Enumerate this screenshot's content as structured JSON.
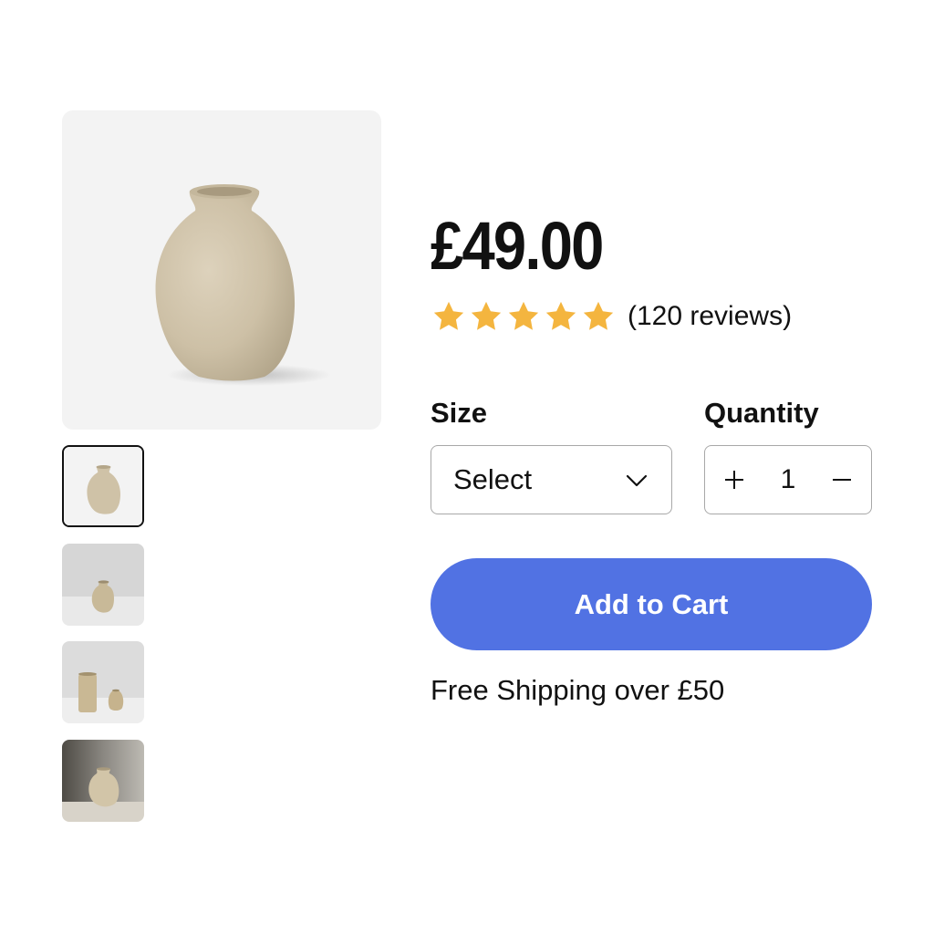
{
  "product": {
    "price": "£49.00",
    "rating": 5,
    "rating_max": 5,
    "reviews_text": "(120 reviews)",
    "star_color": "#f4b53f"
  },
  "gallery": {
    "main_image": "vase-photo",
    "thumbnails": [
      {
        "image": "vase-photo-front",
        "selected": true
      },
      {
        "image": "vase-photo-on-table",
        "selected": false
      },
      {
        "image": "vase-pair-photo",
        "selected": false
      },
      {
        "image": "vase-photo-dark-background",
        "selected": false
      }
    ]
  },
  "options": {
    "size_label": "Size",
    "size_value": "Select",
    "size_icon": "chevron-down-icon",
    "quantity_label": "Quantity",
    "quantity_value": "1",
    "increment_icon": "plus-icon",
    "decrement_icon": "minus-icon"
  },
  "cart": {
    "button_label": "Add to Cart",
    "button_color": "#5172e3"
  },
  "shipping": {
    "text": "Free Shipping over £50"
  }
}
